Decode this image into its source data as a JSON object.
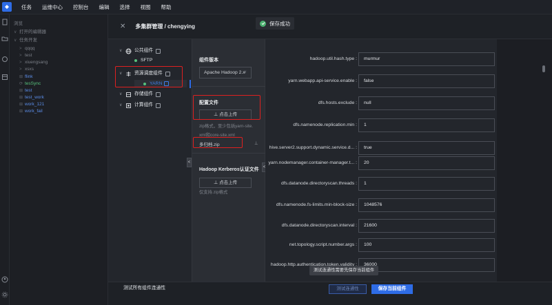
{
  "menubar": {
    "items": [
      "任务",
      "运维中心",
      "控制台",
      "编辑",
      "选择",
      "视图",
      "帮助"
    ]
  },
  "tree": {
    "browse": "浏览",
    "open_editors": "打开的编辑器",
    "task_dev": "任务开发",
    "items": [
      "qqqq",
      "test",
      "xiuengsang",
      "xsxs",
      "flink",
      "tesSync",
      "test",
      "test_work",
      "work_121",
      "work_fail"
    ]
  },
  "dialog": {
    "title": "多集群管理 / chengying"
  },
  "toast": {
    "message": "保存成功"
  },
  "components": {
    "public": "公共组件",
    "sftp": "SFTP",
    "resource": "资源调度组件",
    "yarn": "YARN",
    "storage": "存储组件",
    "compute": "计算组件"
  },
  "config": {
    "version_title": "组件版本",
    "version_value": "Apache Hadoop 2.x",
    "config_file_title": "配置文件",
    "upload_label": "点击上传",
    "config_hint_1": "zip格式，至少包括yarn-site.",
    "config_hint_2": "xml和core-site.xml",
    "file_name": "多归档.zip",
    "kerberos_title": "Hadoop Kerberos认证文件",
    "kerberos_upload": "点击上传",
    "kerberos_hint": "仅支持.zip格式"
  },
  "props": [
    {
      "label": "hadoop.util.hash.type :",
      "value": "murmur"
    },
    {
      "label": "yarn.webapp.api-service.enable :",
      "value": "false"
    },
    {
      "label": "dfs.hosts.exclude :",
      "value": "null"
    },
    {
      "label": "dfs.namenode.replication.min :",
      "value": "1"
    },
    {
      "label": "hive.server2.support.dynamic.service.d... :",
      "value": "true"
    },
    {
      "label": "yarn.nodemanager.container-manager.t... :",
      "value": "20"
    },
    {
      "label": "dfs.datanode.directoryscan.threads :",
      "value": "1"
    },
    {
      "label": "dfs.namenode.fs-limits.min-block-size :",
      "value": "1048576"
    },
    {
      "label": "dfs.datanode.directoryscan.interval :",
      "value": "21600"
    },
    {
      "label": "net.topology.script.number.args :",
      "value": "100"
    },
    {
      "label": "hadoop.http.authentication.token.validity :",
      "value": "36000"
    }
  ],
  "tooltip": "测试连通性需要先保存当前组件",
  "footer": {
    "test_all": "测试所有组件连通性",
    "test_button": "测试连通性",
    "save_button": "保存当前组件"
  },
  "colors": {
    "accent": "#2e6ce6",
    "highlight_border": "#e02020",
    "success": "#4cb070"
  }
}
